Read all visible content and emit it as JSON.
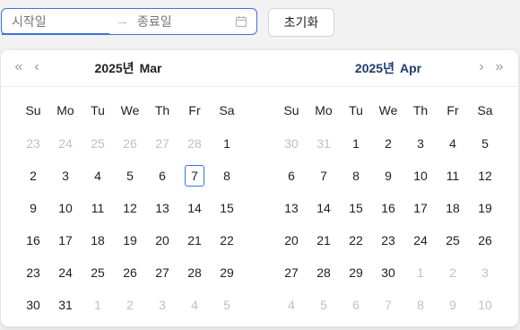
{
  "range": {
    "start_placeholder": "시작일",
    "end_placeholder": "종료일",
    "separator": "→",
    "calendar_icon": "calendar-icon"
  },
  "reset_label": "초기화",
  "nav": {
    "super_prev": "«",
    "prev": "‹",
    "next": "›",
    "super_next": "»"
  },
  "weekdays": [
    "Su",
    "Mo",
    "Tu",
    "We",
    "Th",
    "Fr",
    "Sa"
  ],
  "colors": {
    "accent": "#3b74d9",
    "muted": "#c0c0c0"
  },
  "months": [
    {
      "year": "2025년",
      "month": "Mar",
      "title_color": "#1f1f1f",
      "weeks": [
        [
          {
            "d": "23",
            "o": true
          },
          {
            "d": "24",
            "o": true
          },
          {
            "d": "25",
            "o": true
          },
          {
            "d": "26",
            "o": true
          },
          {
            "d": "27",
            "o": true
          },
          {
            "d": "28",
            "o": true
          },
          {
            "d": "1"
          }
        ],
        [
          {
            "d": "2"
          },
          {
            "d": "3"
          },
          {
            "d": "4"
          },
          {
            "d": "5"
          },
          {
            "d": "6"
          },
          {
            "d": "7",
            "today": true
          },
          {
            "d": "8"
          }
        ],
        [
          {
            "d": "9"
          },
          {
            "d": "10"
          },
          {
            "d": "11"
          },
          {
            "d": "12"
          },
          {
            "d": "13"
          },
          {
            "d": "14"
          },
          {
            "d": "15"
          }
        ],
        [
          {
            "d": "16"
          },
          {
            "d": "17"
          },
          {
            "d": "18"
          },
          {
            "d": "19"
          },
          {
            "d": "20"
          },
          {
            "d": "21"
          },
          {
            "d": "22"
          }
        ],
        [
          {
            "d": "23"
          },
          {
            "d": "24"
          },
          {
            "d": "25"
          },
          {
            "d": "26"
          },
          {
            "d": "27"
          },
          {
            "d": "28"
          },
          {
            "d": "29"
          }
        ],
        [
          {
            "d": "30"
          },
          {
            "d": "31"
          },
          {
            "d": "1",
            "o": true
          },
          {
            "d": "2",
            "o": true
          },
          {
            "d": "3",
            "o": true
          },
          {
            "d": "4",
            "o": true
          },
          {
            "d": "5",
            "o": true
          }
        ]
      ]
    },
    {
      "year": "2025년",
      "month": "Apr",
      "title_color": "#1f3b6e",
      "weeks": [
        [
          {
            "d": "30",
            "o": true
          },
          {
            "d": "31",
            "o": true
          },
          {
            "d": "1"
          },
          {
            "d": "2"
          },
          {
            "d": "3"
          },
          {
            "d": "4"
          },
          {
            "d": "5"
          }
        ],
        [
          {
            "d": "6"
          },
          {
            "d": "7"
          },
          {
            "d": "8"
          },
          {
            "d": "9"
          },
          {
            "d": "10"
          },
          {
            "d": "11"
          },
          {
            "d": "12"
          }
        ],
        [
          {
            "d": "13"
          },
          {
            "d": "14"
          },
          {
            "d": "15"
          },
          {
            "d": "16"
          },
          {
            "d": "17"
          },
          {
            "d": "18"
          },
          {
            "d": "19"
          }
        ],
        [
          {
            "d": "20"
          },
          {
            "d": "21"
          },
          {
            "d": "22"
          },
          {
            "d": "23"
          },
          {
            "d": "24"
          },
          {
            "d": "25"
          },
          {
            "d": "26"
          }
        ],
        [
          {
            "d": "27"
          },
          {
            "d": "28"
          },
          {
            "d": "29"
          },
          {
            "d": "30"
          },
          {
            "d": "1",
            "o": true
          },
          {
            "d": "2",
            "o": true
          },
          {
            "d": "3",
            "o": true
          }
        ],
        [
          {
            "d": "4",
            "o": true
          },
          {
            "d": "5",
            "o": true
          },
          {
            "d": "6",
            "o": true
          },
          {
            "d": "7",
            "o": true
          },
          {
            "d": "8",
            "o": true
          },
          {
            "d": "9",
            "o": true
          },
          {
            "d": "10",
            "o": true
          }
        ]
      ]
    }
  ]
}
